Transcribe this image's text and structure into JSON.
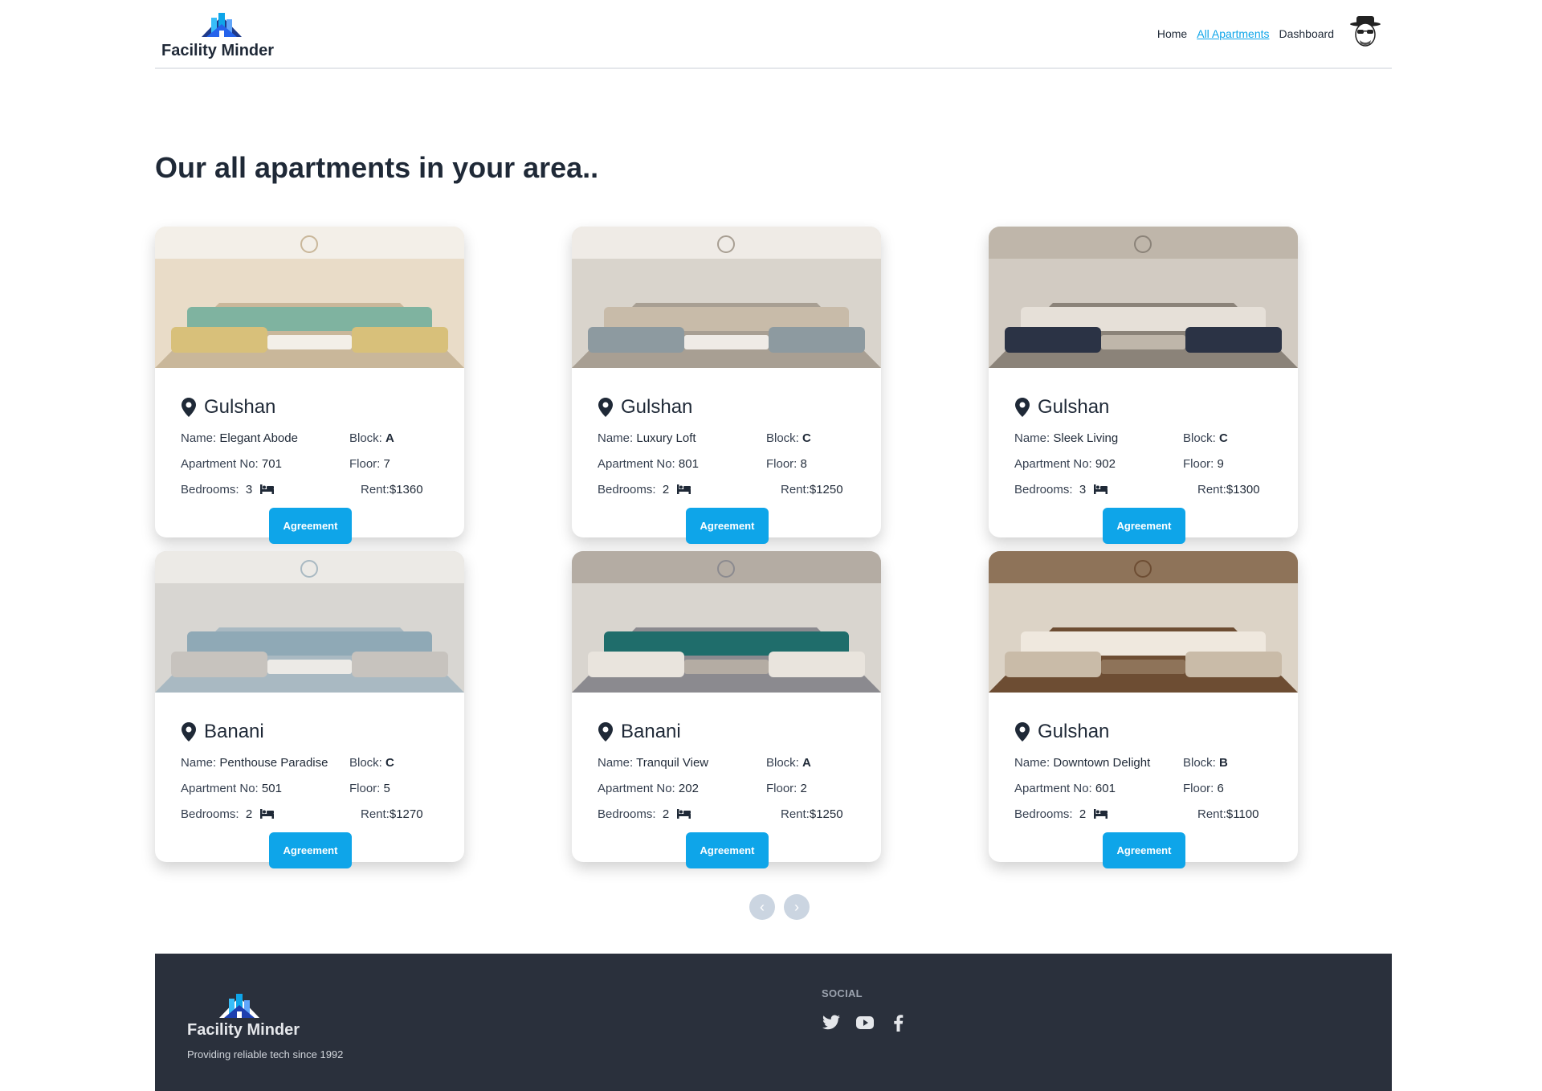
{
  "brand": {
    "name": "Facility Minder"
  },
  "nav": {
    "links": [
      {
        "label": "Home"
      },
      {
        "label": "All Apartments"
      },
      {
        "label": "Dashboard"
      }
    ]
  },
  "page": {
    "title": "Our all apartments in your area.."
  },
  "labels": {
    "name": "Name:",
    "block": "Block:",
    "apartment_no": "Apartment No:",
    "floor": "Floor:",
    "bedrooms": "Bedrooms:",
    "rent": "Rent:",
    "agreement": "Agreement"
  },
  "apartments": [
    {
      "location": "Gulshan",
      "name": "Elegant Abode",
      "block": "A",
      "apartment_no": "701",
      "floor": "7",
      "bedrooms": "3",
      "rent": "$1360"
    },
    {
      "location": "Gulshan",
      "name": "Luxury Loft",
      "block": "C",
      "apartment_no": "801",
      "floor": "8",
      "bedrooms": "2",
      "rent": "$1250"
    },
    {
      "location": "Gulshan",
      "name": "Sleek Living",
      "block": "C",
      "apartment_no": "902",
      "floor": "9",
      "bedrooms": "3",
      "rent": "$1300"
    },
    {
      "location": "Banani",
      "name": "Penthouse Paradise",
      "block": "C",
      "apartment_no": "501",
      "floor": "5",
      "bedrooms": "2",
      "rent": "$1270"
    },
    {
      "location": "Banani",
      "name": "Tranquil View",
      "block": "A",
      "apartment_no": "202",
      "floor": "2",
      "bedrooms": "2",
      "rent": "$1250"
    },
    {
      "location": "Gulshan",
      "name": "Downtown Delight",
      "block": "B",
      "apartment_no": "601",
      "floor": "6",
      "bedrooms": "2",
      "rent": "$1100"
    }
  ],
  "pagination": {
    "prev": "‹",
    "next": "›"
  },
  "footer": {
    "name": "Facility Minder",
    "tagline": "Providing reliable tech since 1992",
    "social_title": "SOCIAL",
    "social_icons": [
      "twitter-icon",
      "youtube-icon",
      "facebook-icon"
    ]
  },
  "colors": {
    "accent": "#0ea5e9",
    "footer_bg": "#2a303c",
    "text": "#1f2937"
  }
}
